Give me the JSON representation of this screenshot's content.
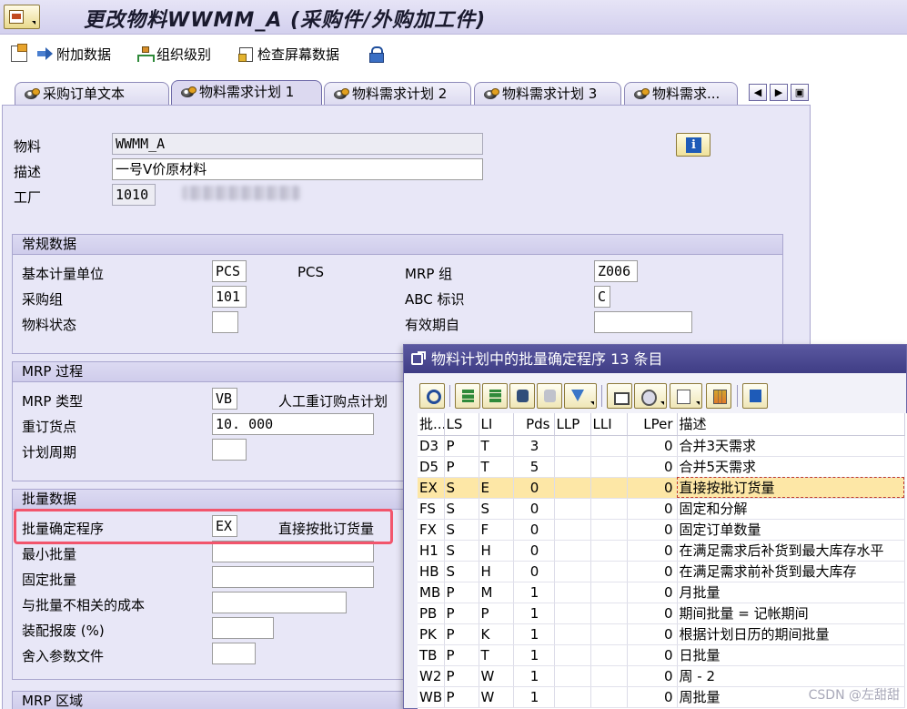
{
  "window": {
    "title": "更改物料WWMM_A (采购件/外购加工件)"
  },
  "toolbar": {
    "additional_data": "附加数据",
    "org_levels": "组织级别",
    "check_screen_data": "检查屏幕数据"
  },
  "tabs": [
    {
      "label": "采购订单文本"
    },
    {
      "label": "物料需求计划 1"
    },
    {
      "label": "物料需求计划 2"
    },
    {
      "label": "物料需求计划 3"
    },
    {
      "label": "物料需求..."
    }
  ],
  "header": {
    "material_label": "物料",
    "material_value": "WWMM_A",
    "description_label": "描述",
    "description_value": "一号V价原材料",
    "plant_label": "工厂",
    "plant_value": "1010"
  },
  "general": {
    "title": "常规数据",
    "base_uom_label": "基本计量单位",
    "base_uom_value": "PCS",
    "base_uom_text": "PCS",
    "mrp_group_label": "MRP 组",
    "mrp_group_value": "Z006",
    "purchasing_group_label": "采购组",
    "purchasing_group_value": "101",
    "abc_label": "ABC 标识",
    "abc_value": "C",
    "material_status_label": "物料状态",
    "material_status_value": "",
    "valid_from_label": "有效期自",
    "valid_from_value": ""
  },
  "mrp_procedure": {
    "title": "MRP 过程",
    "mrp_type_label": "MRP 类型",
    "mrp_type_value": "VB",
    "mrp_type_text": "人工重订购点计划",
    "reorder_point_label": "重订货点",
    "reorder_point_value": "10. 000",
    "planning_cycle_label": "计划周期",
    "planning_cycle_value": ""
  },
  "lot_size": {
    "title": "批量数据",
    "procedure_label": "批量确定程序",
    "procedure_value": "EX",
    "procedure_text": "直接按批订货量",
    "min_lot_label": "最小批量",
    "fixed_lot_label": "固定批量",
    "ordering_cost_label": "与批量不相关的成本",
    "assembly_scrap_label": "装配报废 (%)",
    "rounding_profile_label": "舍入参数文件"
  },
  "mrp_area": {
    "title": "MRP 区域"
  },
  "popup": {
    "title": "物料计划中的批量确定程序 13 条目",
    "columns": [
      "批...",
      "LS",
      "LI",
      "Pds",
      "LLP",
      "LLI",
      "LPer",
      "描述"
    ],
    "rows": [
      {
        "code": "D3",
        "ls": "P",
        "li": "T",
        "pds": "3",
        "llp": "",
        "lli": "",
        "lper": "0",
        "desc": "合并3天需求"
      },
      {
        "code": "D5",
        "ls": "P",
        "li": "T",
        "pds": "5",
        "llp": "",
        "lli": "",
        "lper": "0",
        "desc": "合并5天需求"
      },
      {
        "code": "EX",
        "ls": "S",
        "li": "E",
        "pds": "0",
        "llp": "",
        "lli": "",
        "lper": "0",
        "desc": "直接按批订货量"
      },
      {
        "code": "FS",
        "ls": "S",
        "li": "S",
        "pds": "0",
        "llp": "",
        "lli": "",
        "lper": "0",
        "desc": "固定和分解"
      },
      {
        "code": "FX",
        "ls": "S",
        "li": "F",
        "pds": "0",
        "llp": "",
        "lli": "",
        "lper": "0",
        "desc": "固定订单数量"
      },
      {
        "code": "H1",
        "ls": "S",
        "li": "H",
        "pds": "0",
        "llp": "",
        "lli": "",
        "lper": "0",
        "desc": "在满足需求后补货到最大库存水平"
      },
      {
        "code": "HB",
        "ls": "S",
        "li": "H",
        "pds": "0",
        "llp": "",
        "lli": "",
        "lper": "0",
        "desc": "在满足需求前补货到最大库存"
      },
      {
        "code": "MB",
        "ls": "P",
        "li": "M",
        "pds": "1",
        "llp": "",
        "lli": "",
        "lper": "0",
        "desc": "月批量"
      },
      {
        "code": "PB",
        "ls": "P",
        "li": "P",
        "pds": "1",
        "llp": "",
        "lli": "",
        "lper": "0",
        "desc": "期间批量 = 记帐期间"
      },
      {
        "code": "PK",
        "ls": "P",
        "li": "K",
        "pds": "1",
        "llp": "",
        "lli": "",
        "lper": "0",
        "desc": "根据计划日历的期间批量"
      },
      {
        "code": "TB",
        "ls": "P",
        "li": "T",
        "pds": "1",
        "llp": "",
        "lli": "",
        "lper": "0",
        "desc": "日批量"
      },
      {
        "code": "W2",
        "ls": "P",
        "li": "W",
        "pds": "1",
        "llp": "",
        "lli": "",
        "lper": "0",
        "desc": "周 - 2"
      },
      {
        "code": "WB",
        "ls": "P",
        "li": "W",
        "pds": "1",
        "llp": "",
        "lli": "",
        "lper": "0",
        "desc": "周批量"
      }
    ],
    "selected_index": 2
  },
  "watermark": "CSDN @左甜甜",
  "colors": {
    "panel_bg": "#e8e7f7",
    "popup_title_bg": "#4a4892",
    "selected_row": "#fde7a6",
    "highlight_border": "#f2556c"
  }
}
